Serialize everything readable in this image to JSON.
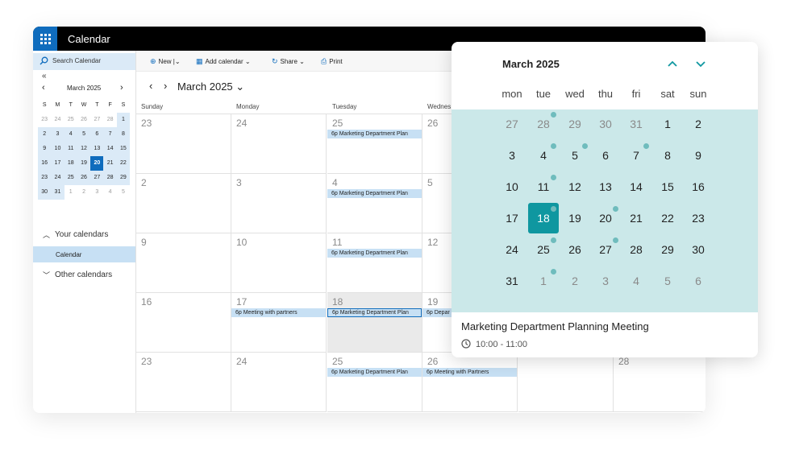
{
  "app": {
    "title": "Calendar"
  },
  "sidebar": {
    "search_placeholder": "Search Calendar",
    "collapse_glyph": "«",
    "mini_calendar": {
      "title": "March 2025",
      "weekdays": [
        "S",
        "M",
        "T",
        "W",
        "T",
        "F",
        "S"
      ],
      "weeks": [
        [
          {
            "d": "23",
            "s": "other"
          },
          {
            "d": "24",
            "s": "other"
          },
          {
            "d": "25",
            "s": "other"
          },
          {
            "d": "26",
            "s": "other"
          },
          {
            "d": "27",
            "s": "other"
          },
          {
            "d": "28",
            "s": "other"
          },
          {
            "d": "1",
            "s": "cur"
          }
        ],
        [
          {
            "d": "2",
            "s": "cur"
          },
          {
            "d": "3",
            "s": "cur"
          },
          {
            "d": "4",
            "s": "cur"
          },
          {
            "d": "5",
            "s": "cur"
          },
          {
            "d": "6",
            "s": "cur"
          },
          {
            "d": "7",
            "s": "cur"
          },
          {
            "d": "8",
            "s": "cur"
          }
        ],
        [
          {
            "d": "9",
            "s": "cur"
          },
          {
            "d": "10",
            "s": "cur"
          },
          {
            "d": "11",
            "s": "cur"
          },
          {
            "d": "12",
            "s": "cur"
          },
          {
            "d": "13",
            "s": "cur"
          },
          {
            "d": "14",
            "s": "cur"
          },
          {
            "d": "15",
            "s": "cur"
          }
        ],
        [
          {
            "d": "16",
            "s": "cur"
          },
          {
            "d": "17",
            "s": "cur"
          },
          {
            "d": "18",
            "s": "cur"
          },
          {
            "d": "19",
            "s": "cur"
          },
          {
            "d": "20",
            "s": "today"
          },
          {
            "d": "21",
            "s": "cur"
          },
          {
            "d": "22",
            "s": "cur"
          }
        ],
        [
          {
            "d": "23",
            "s": "cur"
          },
          {
            "d": "24",
            "s": "cur"
          },
          {
            "d": "25",
            "s": "cur"
          },
          {
            "d": "26",
            "s": "cur"
          },
          {
            "d": "27",
            "s": "cur"
          },
          {
            "d": "28",
            "s": "cur"
          },
          {
            "d": "29",
            "s": "cur"
          }
        ],
        [
          {
            "d": "30",
            "s": "cur"
          },
          {
            "d": "31",
            "s": "cur"
          },
          {
            "d": "1",
            "s": "out"
          },
          {
            "d": "2",
            "s": "out"
          },
          {
            "d": "3",
            "s": "out"
          },
          {
            "d": "4",
            "s": "out"
          },
          {
            "d": "5",
            "s": "out"
          }
        ]
      ]
    },
    "your_calendars": "Your calendars",
    "calendar_item": "Calendar",
    "other_calendars": "Other calendars"
  },
  "toolbar": {
    "new": "New",
    "add_calendar": "Add calendar",
    "share": "Share",
    "print": "Print"
  },
  "month_view": {
    "title": "March 2025",
    "weekdays": [
      "Sunday",
      "Monday",
      "Tuesday",
      "Wednes"
    ],
    "weeks": [
      {
        "days": [
          "23",
          "24",
          "25",
          "26"
        ],
        "events": [
          {
            "col": 2,
            "text": "6p Marketing Department Plan"
          }
        ]
      },
      {
        "days": [
          "2",
          "3",
          "4",
          "5"
        ],
        "events": [
          {
            "col": 2,
            "text": "6p Marketing Department Plan"
          }
        ]
      },
      {
        "days": [
          "9",
          "10",
          "11",
          "12"
        ],
        "events": [
          {
            "col": 2,
            "text": "6p Marketing Department Plan"
          }
        ]
      },
      {
        "days": [
          "16",
          "17",
          "18",
          "19"
        ],
        "events": [
          {
            "col": 1,
            "text": "6p Meeting with partners"
          },
          {
            "col": 2,
            "text": "6p Marketing Department Plan"
          },
          {
            "col": 3,
            "text": "6p Depar"
          }
        ]
      },
      {
        "days": [
          "23",
          "24",
          "25",
          "26",
          "",
          "28"
        ],
        "events": [
          {
            "col": 2,
            "text": "6p Marketing Department Plan"
          },
          {
            "col": 3,
            "text": "6p Meeting with Partners"
          }
        ]
      }
    ]
  },
  "picker": {
    "title": "March 2025",
    "weekdays": [
      "mon",
      "tue",
      "wed",
      "thu",
      "fri",
      "sat",
      "sun"
    ],
    "weeks": [
      [
        {
          "d": "27",
          "o": true
        },
        {
          "d": "28",
          "o": true,
          "dot": true
        },
        {
          "d": "29",
          "o": true
        },
        {
          "d": "30",
          "o": true
        },
        {
          "d": "31",
          "o": true
        },
        {
          "d": "1"
        },
        {
          "d": "2"
        }
      ],
      [
        {
          "d": "3"
        },
        {
          "d": "4",
          "dot": true
        },
        {
          "d": "5",
          "dot": true
        },
        {
          "d": "6"
        },
        {
          "d": "7",
          "dot": true
        },
        {
          "d": "8"
        },
        {
          "d": "9"
        }
      ],
      [
        {
          "d": "10"
        },
        {
          "d": "11",
          "dot": true
        },
        {
          "d": "12"
        },
        {
          "d": "13"
        },
        {
          "d": "14"
        },
        {
          "d": "15"
        },
        {
          "d": "16"
        }
      ],
      [
        {
          "d": "17"
        },
        {
          "d": "18",
          "sel": true,
          "dot": true
        },
        {
          "d": "19"
        },
        {
          "d": "20",
          "dot": true
        },
        {
          "d": "21"
        },
        {
          "d": "22"
        },
        {
          "d": "23"
        }
      ],
      [
        {
          "d": "24"
        },
        {
          "d": "25",
          "dot": true
        },
        {
          "d": "26"
        },
        {
          "d": "27",
          "dot": true
        },
        {
          "d": "28"
        },
        {
          "d": "29"
        },
        {
          "d": "30"
        }
      ],
      [
        {
          "d": "31"
        },
        {
          "d": "1",
          "o": true,
          "dot": true
        },
        {
          "d": "2",
          "o": true
        },
        {
          "d": "3",
          "o": true
        },
        {
          "d": "4",
          "o": true
        },
        {
          "d": "5",
          "o": true
        },
        {
          "d": "6",
          "o": true
        }
      ]
    ],
    "event_title": "Marketing Department Planning Meeting",
    "event_time": "10:00 - 11:00"
  },
  "colors": {
    "accent": "#0f6cbd",
    "event_bg": "#c7e0f4",
    "picker_bg": "#cbe8e9",
    "picker_selected": "#0f97a0",
    "picker_dot": "#6fbcbd"
  },
  "icons": [
    "waffle-icon",
    "search-icon",
    "chevron-left-icon",
    "chevron-right-icon",
    "plus-icon",
    "share-icon",
    "print-icon",
    "chevron-up-icon",
    "chevron-down-icon",
    "clock-icon"
  ]
}
